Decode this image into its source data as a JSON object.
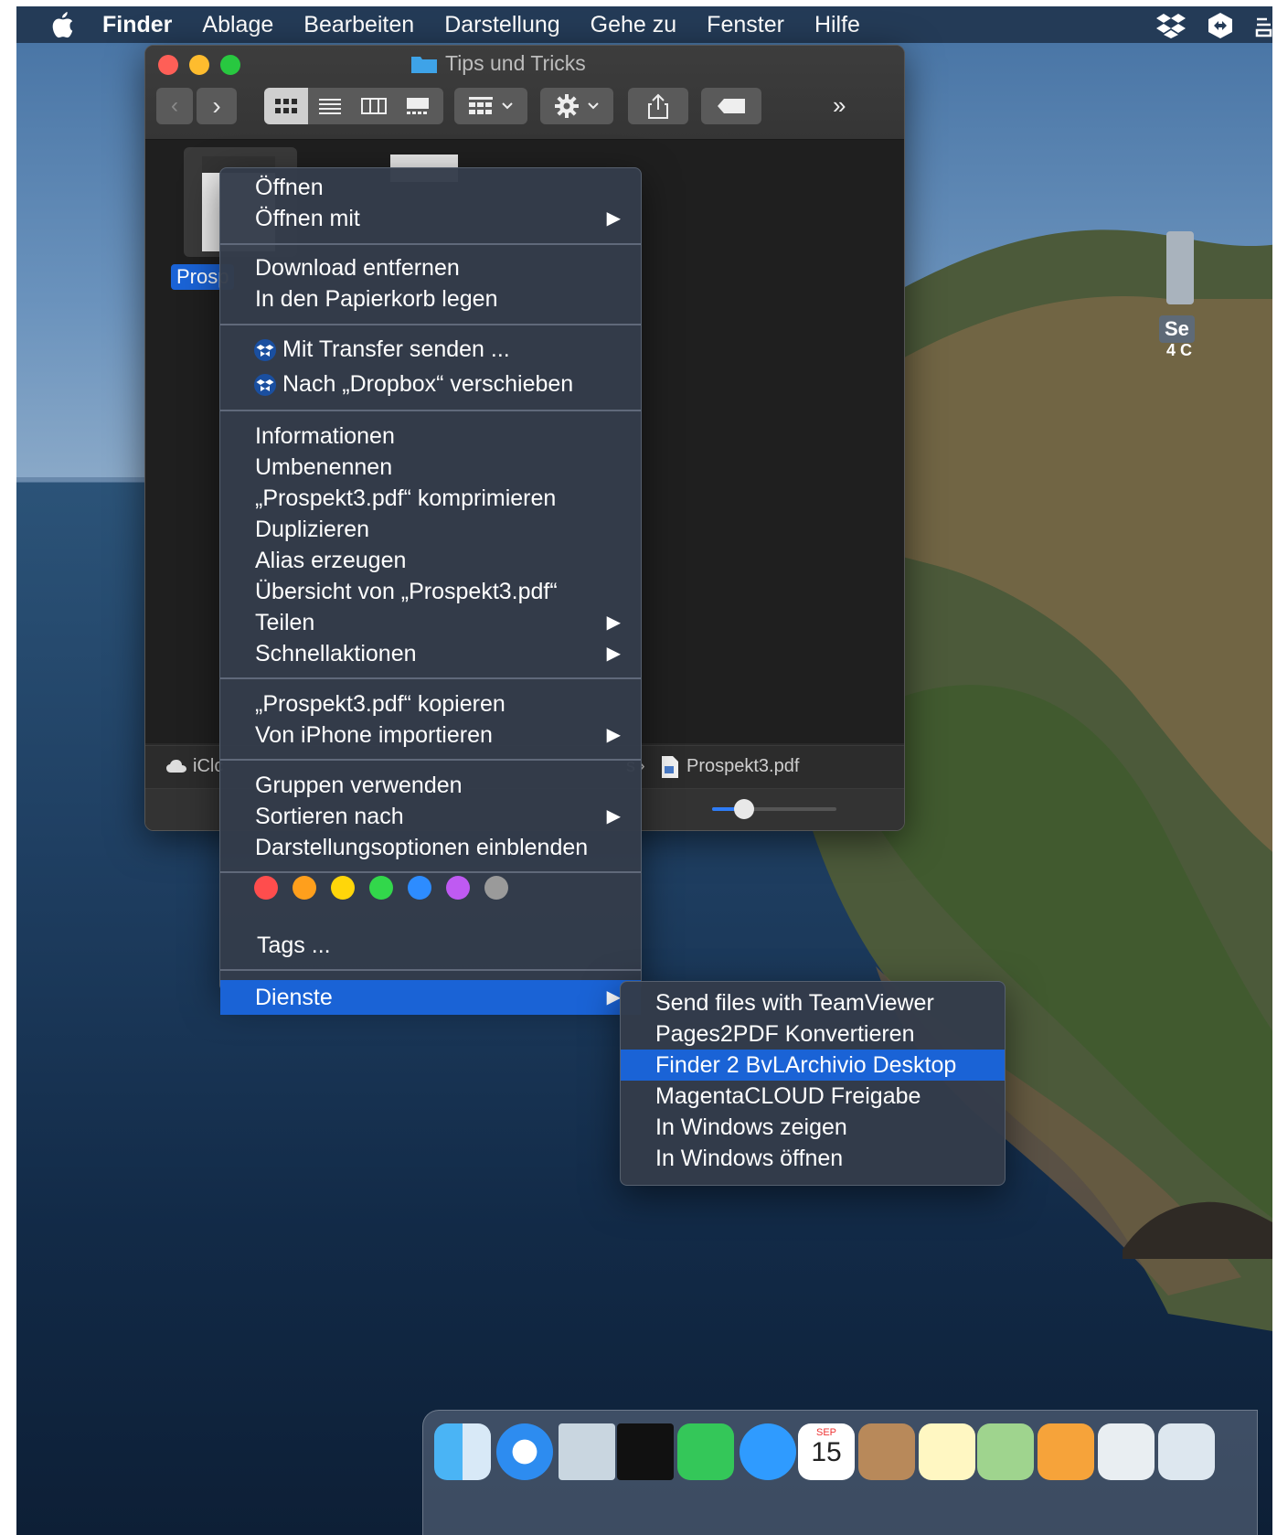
{
  "menubar": {
    "items": [
      {
        "label": "Finder",
        "bold": true
      },
      {
        "label": "Ablage"
      },
      {
        "label": "Bearbeiten"
      },
      {
        "label": "Darstellung"
      },
      {
        "label": "Gehe zu"
      },
      {
        "label": "Fenster"
      },
      {
        "label": "Hilfe"
      }
    ]
  },
  "window": {
    "title": "Tips und Tricks",
    "file_label": "Prosp",
    "path": {
      "start": "iClc",
      "mid": "s",
      "file": "Prospekt3.pdf"
    }
  },
  "desktop": {
    "volume_label_1": "Se",
    "volume_label_2": "4 C"
  },
  "context_menu": {
    "open": "Öffnen",
    "open_with": "Öffnen mit",
    "remove_download": "Download entfernen",
    "trash": "In den Papierkorb legen",
    "transfer": "Mit Transfer senden ...",
    "move_dropbox": "Nach „Dropbox“ verschieben",
    "info": "Informationen",
    "rename": "Umbenennen",
    "compress": "„Prospekt3.pdf“ komprimieren",
    "duplicate": "Duplizieren",
    "alias": "Alias erzeugen",
    "quicklook": "Übersicht von „Prospekt3.pdf“",
    "share": "Teilen",
    "quick_actions": "Schnellaktionen",
    "copy": "„Prospekt3.pdf“ kopieren",
    "import_iphone": "Von iPhone importieren",
    "use_groups": "Gruppen verwenden",
    "sort_by": "Sortieren nach",
    "view_options": "Darstellungsoptionen einblenden",
    "tags": "Tags ...",
    "services": "Dienste",
    "tag_colors": [
      "#ff4d4d",
      "#ff9f1c",
      "#ffd60a",
      "#32d74b",
      "#2d8cff",
      "#bf5af2",
      "#9a9a9a"
    ]
  },
  "services_menu": {
    "items": [
      "Send files with TeamViewer",
      "Pages2PDF Konvertieren",
      "Finder 2 BvLArchivio Desktop",
      "MagentaCLOUD Freigabe",
      "In Windows zeigen",
      "In Windows öffnen"
    ]
  },
  "dock": {
    "calendar_month": "SEP",
    "calendar_day": "15"
  },
  "colors": {
    "accent": "#1a63d6",
    "menu_bg": "#343c4a"
  }
}
